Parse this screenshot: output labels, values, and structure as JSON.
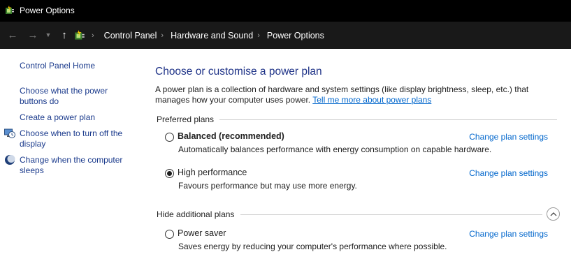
{
  "window": {
    "title": "Power Options",
    "icon": "power-options-icon"
  },
  "address_bar": {
    "breadcrumbs": [
      "Control Panel",
      "Hardware and Sound",
      "Power Options"
    ]
  },
  "left_pane": {
    "home_link": "Control Panel Home",
    "links": [
      "Choose what the power buttons do",
      "Create a power plan",
      "Choose when to turn off the display",
      "Change when the computer sleeps"
    ]
  },
  "main": {
    "heading": "Choose or customise a power plan",
    "intro_text": "A power plan is a collection of hardware and system settings (like display brightness, sleep, etc.) that manages how your computer uses power.",
    "intro_link": "Tell me more about power plans",
    "preferred_header": "Preferred plans",
    "hidden_header": "Hide additional plans",
    "change_link_label": "Change plan settings",
    "plans": [
      {
        "name": "Balanced (recommended)",
        "description": "Automatically balances performance with energy consumption on capable hardware.",
        "selected": false
      },
      {
        "name": "High performance",
        "description": "Favours performance but may use more energy.",
        "selected": true
      },
      {
        "name": "Power saver",
        "description": "Saves energy by reducing your computer's performance where possible.",
        "selected": false
      }
    ]
  },
  "colors": {
    "title_bar": "#000000",
    "address_bar": "#191919",
    "link": "#0066cc",
    "heading": "#1e3287"
  }
}
